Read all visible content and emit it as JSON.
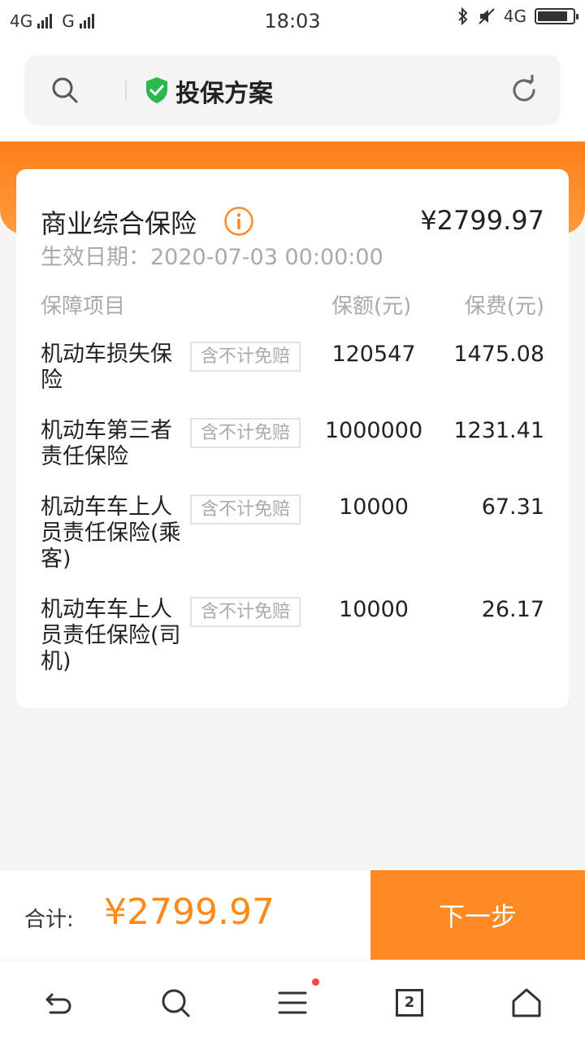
{
  "status_bar": {
    "network_left_1": "4G",
    "network_left_2": "G",
    "time": "18:03",
    "network_right": "4G"
  },
  "header": {
    "title": "投保方案"
  },
  "plan": {
    "title": "商业综合保险",
    "price": "¥2799.97",
    "effective_date": "生效日期：2020-07-03 00:00:00",
    "columns": {
      "item": "保障项目",
      "amount": "保额(元)",
      "premium": "保费(元)"
    },
    "rows": [
      {
        "name": "机动车损失保险",
        "tag": "含不计免赔",
        "amount": "120547",
        "premium": "1475.08"
      },
      {
        "name": "机动车第三者责任保险",
        "tag": "含不计免赔",
        "amount": "1000000",
        "premium": "1231.41"
      },
      {
        "name": "机动车车上人员责任保险(乘客)",
        "tag": "含不计免赔",
        "amount": "10000",
        "premium": "67.31"
      },
      {
        "name": "机动车车上人员责任保险(司机)",
        "tag": "含不计免赔",
        "amount": "10000",
        "premium": "26.17"
      }
    ]
  },
  "footer": {
    "total_label": "合计:",
    "total_value": "¥2799.97",
    "next_label": "下一步"
  },
  "nav": {
    "tab_count": "2"
  },
  "colors": {
    "accent": "#ff8a24",
    "shield": "#2db84d"
  }
}
